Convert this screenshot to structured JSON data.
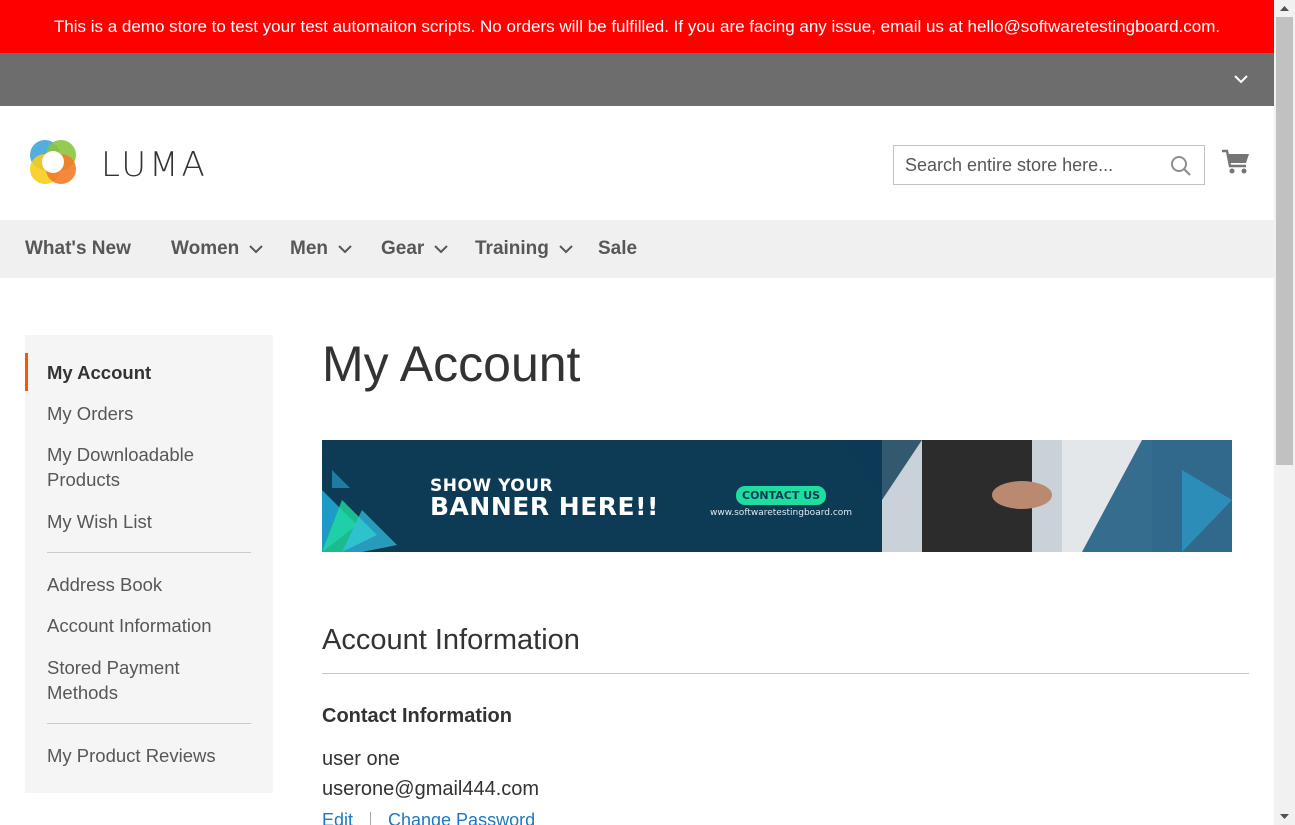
{
  "notice": {
    "text": "This is a demo store to test your test automaiton scripts. No orders will be fulfilled. If you are facing any issue, email us at hello@softwaretestingboard.com."
  },
  "header": {
    "logo_text": "LUMA",
    "search_placeholder": "Search entire store here..."
  },
  "nav": {
    "items": [
      {
        "label": "What's New",
        "dropdown": false
      },
      {
        "label": "Women",
        "dropdown": true
      },
      {
        "label": "Men",
        "dropdown": true
      },
      {
        "label": "Gear",
        "dropdown": true
      },
      {
        "label": "Training",
        "dropdown": true
      },
      {
        "label": "Sale",
        "dropdown": false
      }
    ]
  },
  "sidebar": {
    "items": [
      {
        "label": "My Account",
        "active": true
      },
      {
        "label": "My Orders"
      },
      {
        "label": "My Downloadable Products"
      },
      {
        "label": "My Wish List"
      },
      {
        "label": "Address Book"
      },
      {
        "label": "Account Information"
      },
      {
        "label": "Stored Payment Methods"
      },
      {
        "label": "My Product Reviews"
      }
    ]
  },
  "main": {
    "page_title": "My Account",
    "banner": {
      "line1": "SHOW YOUR",
      "line2": "BANNER HERE!!",
      "button": "CONTACT US",
      "url": "www.softwaretestingboard.com"
    },
    "section_title": "Account Information",
    "contact": {
      "title": "Contact Information",
      "name": "user one",
      "email": "userone@gmail444.com",
      "edit_label": "Edit",
      "change_password_label": "Change Password"
    }
  },
  "colors": {
    "notice_bg": "#ff0000",
    "panel_bg": "#6d6d6d",
    "nav_bg": "#f0f0f0",
    "active_accent": "#ff5501",
    "link": "#1979c3"
  }
}
